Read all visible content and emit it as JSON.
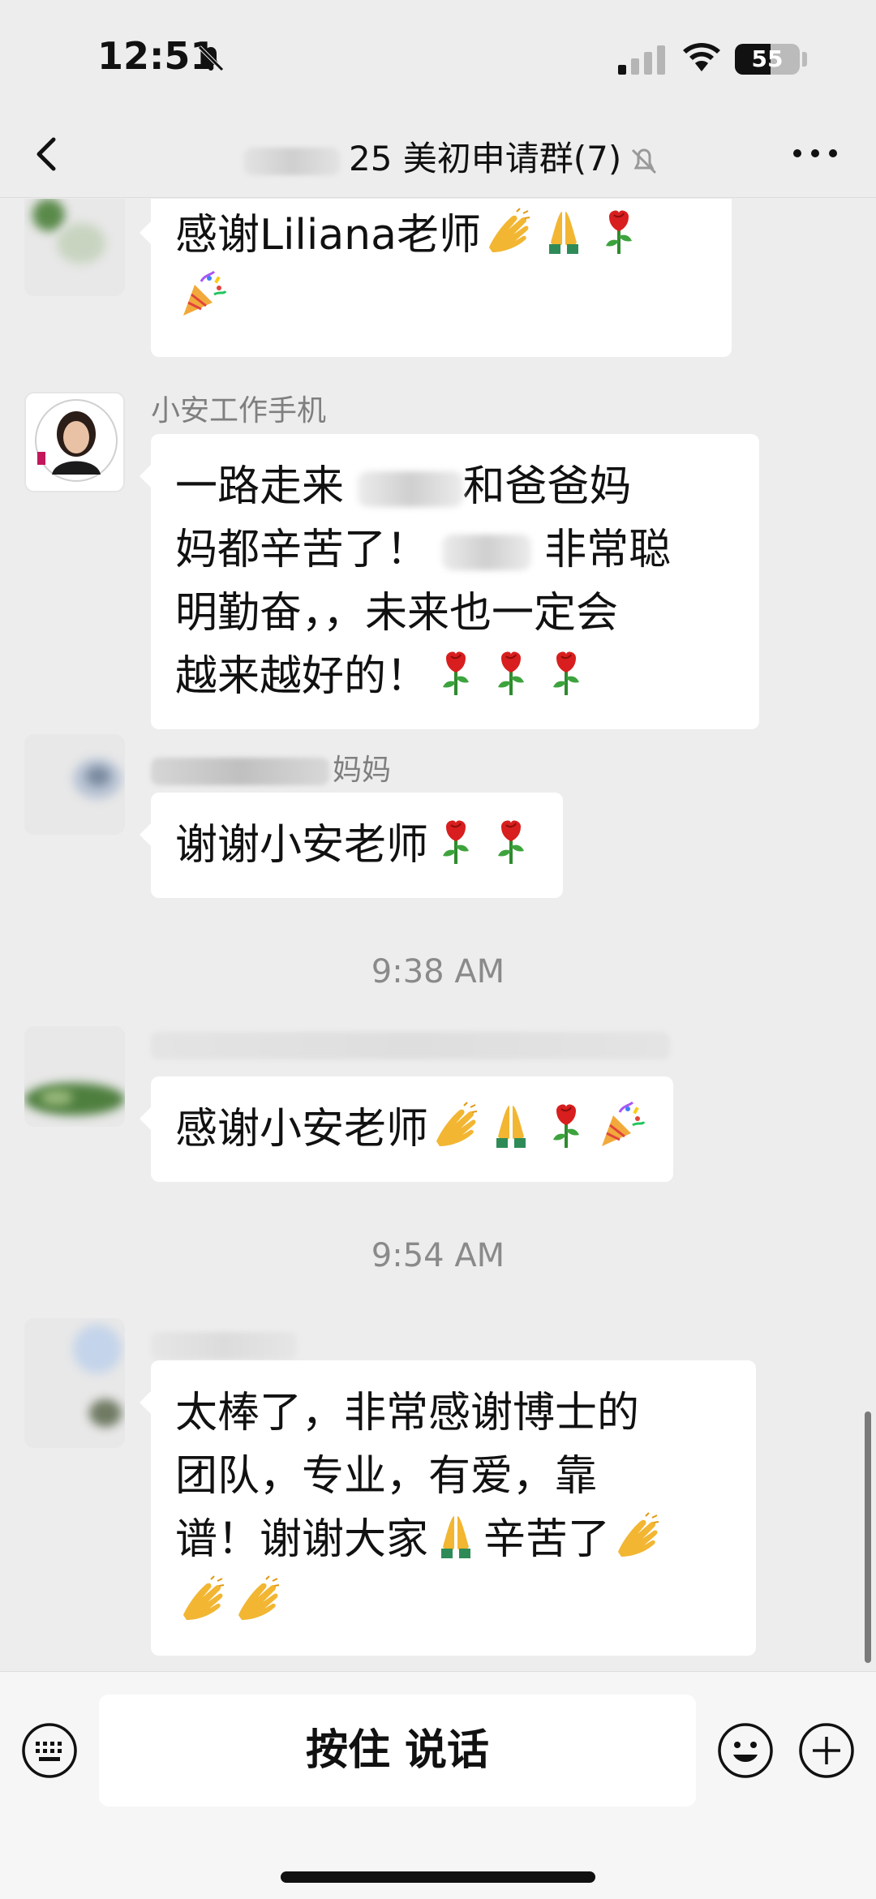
{
  "status": {
    "time": "12:51",
    "battery": "55",
    "battery_level": 0.55
  },
  "nav": {
    "title": "25 美初申请群(7)"
  },
  "messages": {
    "m1_text": "感谢Liliana老师",
    "m2_sender": "小安工作手机",
    "m2_l1a": "一路走来",
    "m2_l1b": "和爸爸妈",
    "m2_l2a": "妈都辛苦了！",
    "m2_l2b": "非常聪",
    "m2_l3": "明勤奋，，未来也一定会",
    "m2_l4": "越来越好的！",
    "m3_sender_tail": "妈妈",
    "m3_text": "谢谢小安老师",
    "time1": "9:38 AM",
    "m4_text": "感谢小安老师",
    "time2": "9:54 AM",
    "m5_l1": "太棒了，非常感谢博士的",
    "m5_l2": "团队，专业，有爱，靠",
    "m5_l3a": "谱！谢谢大家",
    "m5_l3b": "辛苦了"
  },
  "input": {
    "hold_to_talk": "按住 说话"
  },
  "icons": [
    "back-icon",
    "mute-icon",
    "more-icon",
    "keyboard-icon",
    "emoji-icon",
    "plus-icon",
    "clap-emoji",
    "pray-emoji",
    "rose-emoji",
    "party-emoji"
  ]
}
